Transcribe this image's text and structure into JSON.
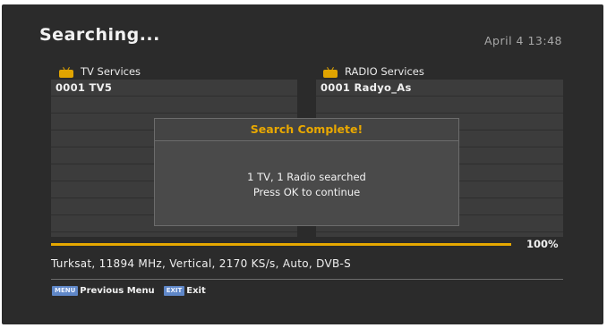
{
  "header": {
    "title": "Searching...",
    "datetime": "April 4 13:48"
  },
  "tv_services": {
    "label": "TV Services",
    "icon": "tv-icon",
    "items": [
      "0001 TV5"
    ]
  },
  "radio_services": {
    "label": "RADIO Services",
    "icon": "radio-icon",
    "items": [
      "0001 Radyo_As"
    ]
  },
  "dialog": {
    "title": "Search Complete!",
    "line1": "1 TV, 1 Radio searched",
    "line2": "Press OK to continue"
  },
  "progress": {
    "value": 1.0,
    "label": "100%"
  },
  "transponder_info": "Turksat, 11894 MHz, Vertical, 2170 KS/s, Auto, DVB-S",
  "footer": {
    "menu_key": "MENU",
    "menu_label": "Previous Menu",
    "exit_key": "EXIT",
    "exit_label": "Exit"
  },
  "colors": {
    "accent": "#e6a800",
    "key_blue": "#5f87c8",
    "background": "#2b2b2b"
  }
}
